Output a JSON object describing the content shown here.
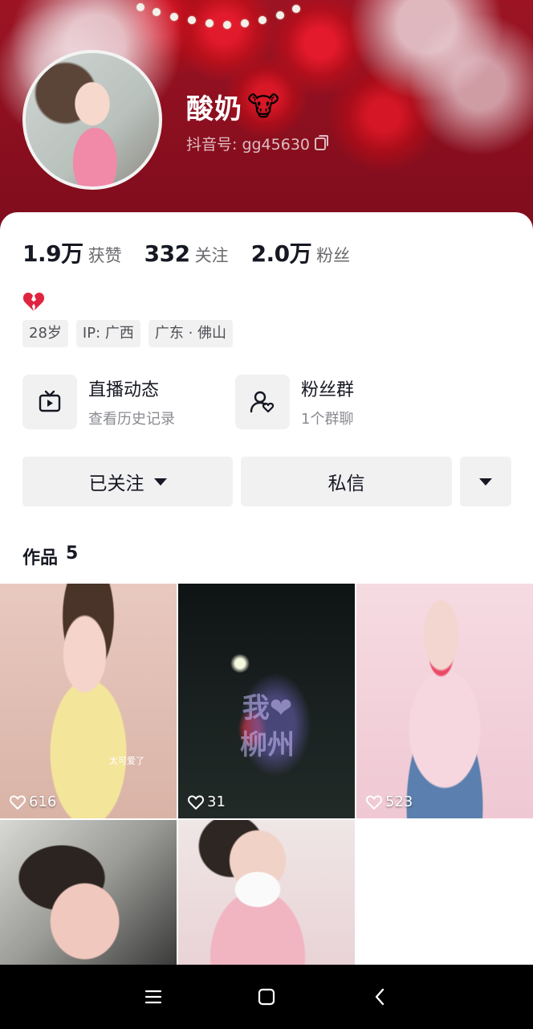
{
  "profile": {
    "name": "酸奶",
    "name_emoji": "🐮",
    "uid_label": "抖音号: gg45630"
  },
  "stats": [
    {
      "value": "1.9万",
      "label": "获赞"
    },
    {
      "value": "332",
      "label": "关注"
    },
    {
      "value": "2.0万",
      "label": "粉丝"
    }
  ],
  "tags": [
    "28岁",
    "IP: 广西",
    "广东 · 佛山"
  ],
  "features": [
    {
      "title": "直播动态",
      "subtitle": "查看历史记录",
      "icon": "tv-icon"
    },
    {
      "title": "粉丝群",
      "subtitle": "1个群聊",
      "icon": "group-icon"
    }
  ],
  "actions": {
    "follow_label": "已关注",
    "message_label": "私信"
  },
  "works": {
    "label": "作品",
    "count": "5",
    "items": [
      {
        "likes": "616",
        "caption": "太可爱了"
      },
      {
        "likes": "31",
        "overlay_text": "我❤柳州"
      },
      {
        "likes": "523"
      },
      {},
      {}
    ]
  },
  "navbar": {
    "icons": [
      "menu-icon",
      "home-icon",
      "back-icon"
    ]
  },
  "colors": {
    "banner": "#8a0f1f",
    "card": "#ffffff",
    "chip": "#f1f1f2",
    "text_primary": "#161823",
    "text_secondary": "#6b6b6f"
  }
}
